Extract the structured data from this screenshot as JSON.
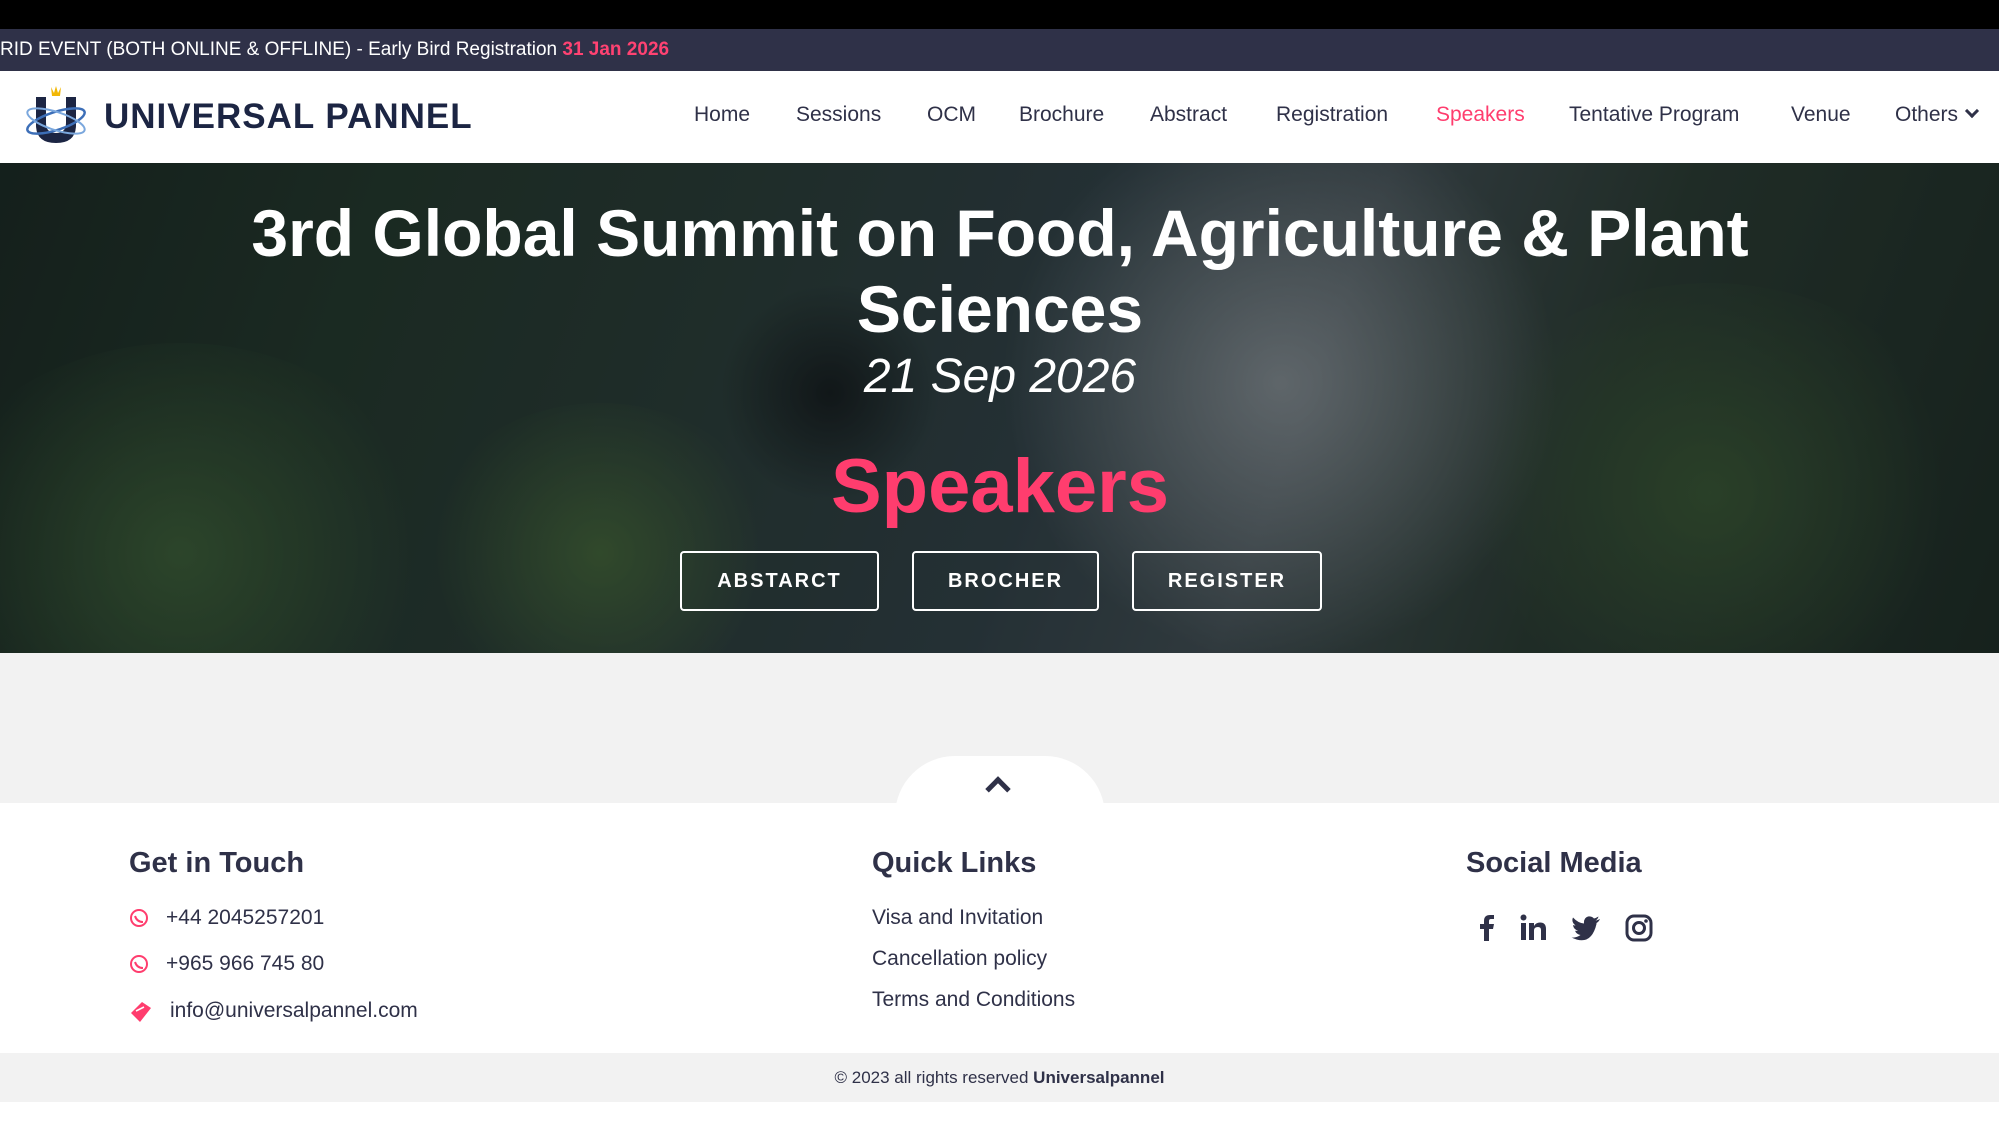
{
  "ticker": {
    "text": "RID EVENT (BOTH ONLINE & OFFLINE) - Early Bird Registration ",
    "date": "31 Jan 2026"
  },
  "brand": {
    "name": "UNIVERSAL PANNEL"
  },
  "nav": {
    "items": [
      {
        "label": "Home"
      },
      {
        "label": "Sessions"
      },
      {
        "label": "OCM"
      },
      {
        "label": "Brochure"
      },
      {
        "label": "Abstract"
      },
      {
        "label": "Registration"
      },
      {
        "label": "Speakers",
        "active": true
      },
      {
        "label": "Tentative Program"
      },
      {
        "label": "Venue"
      },
      {
        "label": "Others"
      }
    ]
  },
  "hero": {
    "title": "3rd Global Summit on Food, Agriculture & Plant Sciences",
    "date": "21 Sep 2026",
    "section": "Speakers",
    "buttons": [
      {
        "label": "ABSTARCT"
      },
      {
        "label": "BROCHER"
      },
      {
        "label": "REGISTER"
      }
    ]
  },
  "footer": {
    "contact": {
      "heading": "Get in Touch",
      "phone1": "+44 2045257201",
      "phone2": "+965 966 745 80",
      "email": "info@universalpannel.com"
    },
    "links": {
      "heading": "Quick Links",
      "items": [
        {
          "label": "Visa and Invitation"
        },
        {
          "label": "Cancellation policy"
        },
        {
          "label": "Terms and Conditions"
        }
      ]
    },
    "social": {
      "heading": "Social Media",
      "icons": [
        "facebook-icon",
        "linkedin-icon",
        "twitter-icon",
        "instagram-icon"
      ]
    }
  },
  "copyright": {
    "text": "© 2023 all rights reserved ",
    "brand": "Universalpannel"
  },
  "colors": {
    "accent": "#ff3d6e",
    "dark": "#2f3148",
    "ticker_bg": "#2f3148"
  }
}
